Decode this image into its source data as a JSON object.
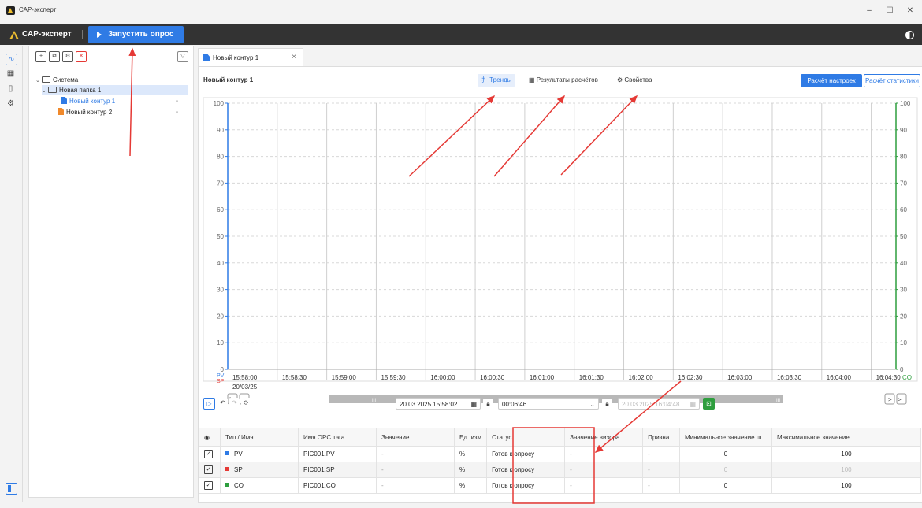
{
  "window": {
    "title": "САР-эксперт",
    "minimize": "–",
    "maximize": "☐",
    "close": "✕"
  },
  "header": {
    "brand": "САР-эксперт",
    "start_button": "Запустить опрос"
  },
  "tree": {
    "root": "Система",
    "folder": "Новая папка 1",
    "item1": "Новый контур 1",
    "item2": "Новый контур 2"
  },
  "tab": {
    "label": "Новый контур 1",
    "close": "×"
  },
  "view": {
    "title": "Новый контур 1",
    "tabs": [
      "Тренды",
      "Результаты расчётов",
      "Свойства"
    ],
    "calc_settings": "Расчёт настроек",
    "calc_stats": "Расчёт статистики"
  },
  "chart_data": {
    "type": "line",
    "y_ticks": [
      "100",
      "90",
      "80",
      "70",
      "60",
      "50",
      "40",
      "30",
      "20",
      "10",
      "0"
    ],
    "x_ticks": [
      "15:58:00",
      "15:58:30",
      "15:59:00",
      "15:59:30",
      "16:00:00",
      "16:00:30",
      "16:01:00",
      "16:01:30",
      "16:02:00",
      "16:02:30",
      "16:03:00",
      "16:03:30",
      "16:04:00",
      "16:04:30"
    ],
    "x_date": "20/03/25",
    "left_legend": [
      "PV",
      "SP"
    ],
    "right_legend": "CO",
    "ylim": [
      0,
      100
    ],
    "grid": true,
    "series": []
  },
  "controls": {
    "start_time": "20.03.2025 15:58:02",
    "duration": "00:06:46",
    "end_time": "20.03.2025 16:04:48"
  },
  "table": {
    "headers": [
      "Тип / Имя",
      "Имя OPC тэга",
      "Значение",
      "Ед. изм",
      "Статус",
      "Значение визора",
      "Призна...",
      "Минимальное значение ш...",
      "Максимальное значение ..."
    ],
    "rows": [
      {
        "name": "PV",
        "color": "#2f7be5",
        "tag": "PIC001.PV",
        "value": "-",
        "unit": "%",
        "status": "Готов к опросу",
        "visor": "-",
        "flag": "-",
        "min": "0",
        "max": "100"
      },
      {
        "name": "SP",
        "color": "#e53935",
        "tag": "PIC001.SP",
        "value": "-",
        "unit": "%",
        "status": "Готов к опросу",
        "visor": "-",
        "flag": "-",
        "min": "0",
        "max": "100"
      },
      {
        "name": "CO",
        "color": "#2e9e3e",
        "tag": "PIC001.CO",
        "value": "-",
        "unit": "%",
        "status": "Готов к опросу",
        "visor": "-",
        "flag": "-",
        "min": "0",
        "max": "100"
      }
    ]
  },
  "colors": {
    "accent": "#2f7be5",
    "annotation": "#e53935",
    "co_axis": "#2e9e3e",
    "header_bg": "#333333"
  }
}
